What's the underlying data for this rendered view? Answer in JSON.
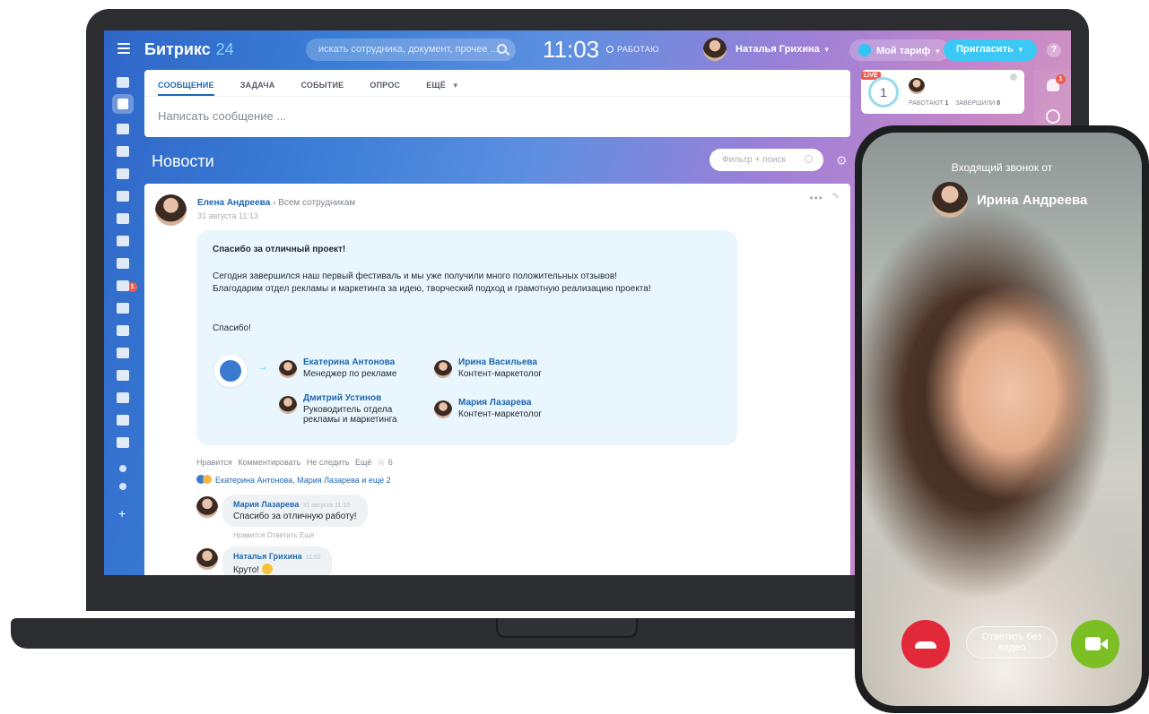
{
  "app": {
    "logo_text": "Битрикс",
    "logo_num": "24"
  },
  "topbar": {
    "search_placeholder": "искать сотрудника, документ, прочее ...",
    "clock": "11:03",
    "work_status": "РАБОТАЮ",
    "user_name": "Наталья Грихина",
    "tariff_label": "Мой тариф",
    "invite_label": "Пригласить",
    "help_label": "?"
  },
  "composer": {
    "tabs": [
      "СООБЩЕНИЕ",
      "ЗАДАЧА",
      "СОБЫТИЕ",
      "ОПРОС",
      "ЕЩЁ"
    ],
    "placeholder": "Написать сообщение ..."
  },
  "news": {
    "title": "Новости",
    "filter_placeholder": "Фильтр + поиск"
  },
  "post": {
    "author": "Елена Андреева",
    "recipients": "Всем сотрудникам",
    "date": "31 августа 11:13",
    "thanks_title": "Спасибо за отличный проект!",
    "body_1": "Сегодня завершился наш первый фестиваль и мы уже получили много положительных отзывов! Благодарим отдел рекламы и маркетинга за идею, творческий подход и грамотную реализацию проекта!",
    "body_2": "Спасибо!",
    "people": [
      {
        "name": "Екатерина Антонова",
        "role": "Менеджер по рекламе"
      },
      {
        "name": "Ирина Васильева",
        "role": "Контент-маркетолог"
      },
      {
        "name": "Дмитрий Устинов",
        "role": "Руководитель отдела рекламы и маркетинга"
      },
      {
        "name": "Мария Лазарева",
        "role": "Контент-маркетолог"
      }
    ],
    "actions": {
      "like": "Нравится",
      "comment": "Комментировать",
      "unfollow": "Не следить",
      "more": "Ещё",
      "views": "6"
    },
    "likers": "Екатерина Антонова, Мария Лазарева и еще 2",
    "comments": [
      {
        "author": "Мария Лазарева",
        "time": "31 августа 11:10",
        "text": "Спасибо за отличную работу!",
        "actions": "Нравится   Ответить   Ещё"
      },
      {
        "author": "Наталья Грихина",
        "time": "11:02",
        "text": "Круто!"
      }
    ]
  },
  "live_card": {
    "tag": "LIVE",
    "count": "1",
    "working_label": "РАБОТАЮТ",
    "working": "1",
    "done_label": "ЗАВЕРШИЛИ",
    "done": "0"
  },
  "notifications": {
    "badge": "1"
  },
  "sidebar": {
    "tasks_badge": "1"
  },
  "call": {
    "incoming_label": "Входящий звонок от",
    "caller_name": "Ирина Андреева",
    "answer_no_video": "Ответить без видео"
  },
  "colors": {
    "accent": "#2067b0",
    "invite": "#3bc8f5",
    "decline": "#e2293a",
    "accept_video": "#7cbf25"
  }
}
